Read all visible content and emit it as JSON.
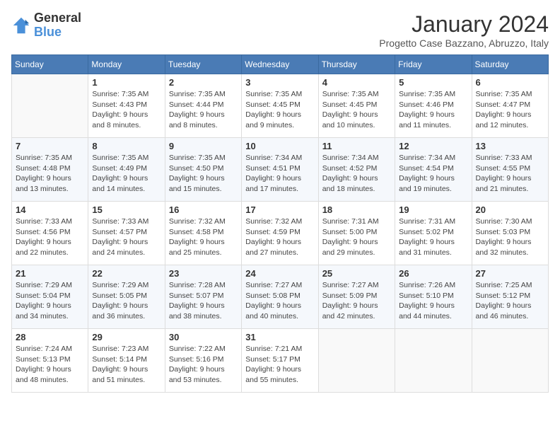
{
  "logo": {
    "general": "General",
    "blue": "Blue"
  },
  "title": "January 2024",
  "subtitle": "Progetto Case Bazzano, Abruzzo, Italy",
  "days_of_week": [
    "Sunday",
    "Monday",
    "Tuesday",
    "Wednesday",
    "Thursday",
    "Friday",
    "Saturday"
  ],
  "weeks": [
    [
      {
        "day": "",
        "sunrise": "",
        "sunset": "",
        "daylight": ""
      },
      {
        "day": "1",
        "sunrise": "Sunrise: 7:35 AM",
        "sunset": "Sunset: 4:43 PM",
        "daylight": "Daylight: 9 hours and 8 minutes."
      },
      {
        "day": "2",
        "sunrise": "Sunrise: 7:35 AM",
        "sunset": "Sunset: 4:44 PM",
        "daylight": "Daylight: 9 hours and 8 minutes."
      },
      {
        "day": "3",
        "sunrise": "Sunrise: 7:35 AM",
        "sunset": "Sunset: 4:45 PM",
        "daylight": "Daylight: 9 hours and 9 minutes."
      },
      {
        "day": "4",
        "sunrise": "Sunrise: 7:35 AM",
        "sunset": "Sunset: 4:45 PM",
        "daylight": "Daylight: 9 hours and 10 minutes."
      },
      {
        "day": "5",
        "sunrise": "Sunrise: 7:35 AM",
        "sunset": "Sunset: 4:46 PM",
        "daylight": "Daylight: 9 hours and 11 minutes."
      },
      {
        "day": "6",
        "sunrise": "Sunrise: 7:35 AM",
        "sunset": "Sunset: 4:47 PM",
        "daylight": "Daylight: 9 hours and 12 minutes."
      }
    ],
    [
      {
        "day": "7",
        "sunrise": "Sunrise: 7:35 AM",
        "sunset": "Sunset: 4:48 PM",
        "daylight": "Daylight: 9 hours and 13 minutes."
      },
      {
        "day": "8",
        "sunrise": "Sunrise: 7:35 AM",
        "sunset": "Sunset: 4:49 PM",
        "daylight": "Daylight: 9 hours and 14 minutes."
      },
      {
        "day": "9",
        "sunrise": "Sunrise: 7:35 AM",
        "sunset": "Sunset: 4:50 PM",
        "daylight": "Daylight: 9 hours and 15 minutes."
      },
      {
        "day": "10",
        "sunrise": "Sunrise: 7:34 AM",
        "sunset": "Sunset: 4:51 PM",
        "daylight": "Daylight: 9 hours and 17 minutes."
      },
      {
        "day": "11",
        "sunrise": "Sunrise: 7:34 AM",
        "sunset": "Sunset: 4:52 PM",
        "daylight": "Daylight: 9 hours and 18 minutes."
      },
      {
        "day": "12",
        "sunrise": "Sunrise: 7:34 AM",
        "sunset": "Sunset: 4:54 PM",
        "daylight": "Daylight: 9 hours and 19 minutes."
      },
      {
        "day": "13",
        "sunrise": "Sunrise: 7:33 AM",
        "sunset": "Sunset: 4:55 PM",
        "daylight": "Daylight: 9 hours and 21 minutes."
      }
    ],
    [
      {
        "day": "14",
        "sunrise": "Sunrise: 7:33 AM",
        "sunset": "Sunset: 4:56 PM",
        "daylight": "Daylight: 9 hours and 22 minutes."
      },
      {
        "day": "15",
        "sunrise": "Sunrise: 7:33 AM",
        "sunset": "Sunset: 4:57 PM",
        "daylight": "Daylight: 9 hours and 24 minutes."
      },
      {
        "day": "16",
        "sunrise": "Sunrise: 7:32 AM",
        "sunset": "Sunset: 4:58 PM",
        "daylight": "Daylight: 9 hours and 25 minutes."
      },
      {
        "day": "17",
        "sunrise": "Sunrise: 7:32 AM",
        "sunset": "Sunset: 4:59 PM",
        "daylight": "Daylight: 9 hours and 27 minutes."
      },
      {
        "day": "18",
        "sunrise": "Sunrise: 7:31 AM",
        "sunset": "Sunset: 5:00 PM",
        "daylight": "Daylight: 9 hours and 29 minutes."
      },
      {
        "day": "19",
        "sunrise": "Sunrise: 7:31 AM",
        "sunset": "Sunset: 5:02 PM",
        "daylight": "Daylight: 9 hours and 31 minutes."
      },
      {
        "day": "20",
        "sunrise": "Sunrise: 7:30 AM",
        "sunset": "Sunset: 5:03 PM",
        "daylight": "Daylight: 9 hours and 32 minutes."
      }
    ],
    [
      {
        "day": "21",
        "sunrise": "Sunrise: 7:29 AM",
        "sunset": "Sunset: 5:04 PM",
        "daylight": "Daylight: 9 hours and 34 minutes."
      },
      {
        "day": "22",
        "sunrise": "Sunrise: 7:29 AM",
        "sunset": "Sunset: 5:05 PM",
        "daylight": "Daylight: 9 hours and 36 minutes."
      },
      {
        "day": "23",
        "sunrise": "Sunrise: 7:28 AM",
        "sunset": "Sunset: 5:07 PM",
        "daylight": "Daylight: 9 hours and 38 minutes."
      },
      {
        "day": "24",
        "sunrise": "Sunrise: 7:27 AM",
        "sunset": "Sunset: 5:08 PM",
        "daylight": "Daylight: 9 hours and 40 minutes."
      },
      {
        "day": "25",
        "sunrise": "Sunrise: 7:27 AM",
        "sunset": "Sunset: 5:09 PM",
        "daylight": "Daylight: 9 hours and 42 minutes."
      },
      {
        "day": "26",
        "sunrise": "Sunrise: 7:26 AM",
        "sunset": "Sunset: 5:10 PM",
        "daylight": "Daylight: 9 hours and 44 minutes."
      },
      {
        "day": "27",
        "sunrise": "Sunrise: 7:25 AM",
        "sunset": "Sunset: 5:12 PM",
        "daylight": "Daylight: 9 hours and 46 minutes."
      }
    ],
    [
      {
        "day": "28",
        "sunrise": "Sunrise: 7:24 AM",
        "sunset": "Sunset: 5:13 PM",
        "daylight": "Daylight: 9 hours and 48 minutes."
      },
      {
        "day": "29",
        "sunrise": "Sunrise: 7:23 AM",
        "sunset": "Sunset: 5:14 PM",
        "daylight": "Daylight: 9 hours and 51 minutes."
      },
      {
        "day": "30",
        "sunrise": "Sunrise: 7:22 AM",
        "sunset": "Sunset: 5:16 PM",
        "daylight": "Daylight: 9 hours and 53 minutes."
      },
      {
        "day": "31",
        "sunrise": "Sunrise: 7:21 AM",
        "sunset": "Sunset: 5:17 PM",
        "daylight": "Daylight: 9 hours and 55 minutes."
      },
      {
        "day": "",
        "sunrise": "",
        "sunset": "",
        "daylight": ""
      },
      {
        "day": "",
        "sunrise": "",
        "sunset": "",
        "daylight": ""
      },
      {
        "day": "",
        "sunrise": "",
        "sunset": "",
        "daylight": ""
      }
    ]
  ]
}
